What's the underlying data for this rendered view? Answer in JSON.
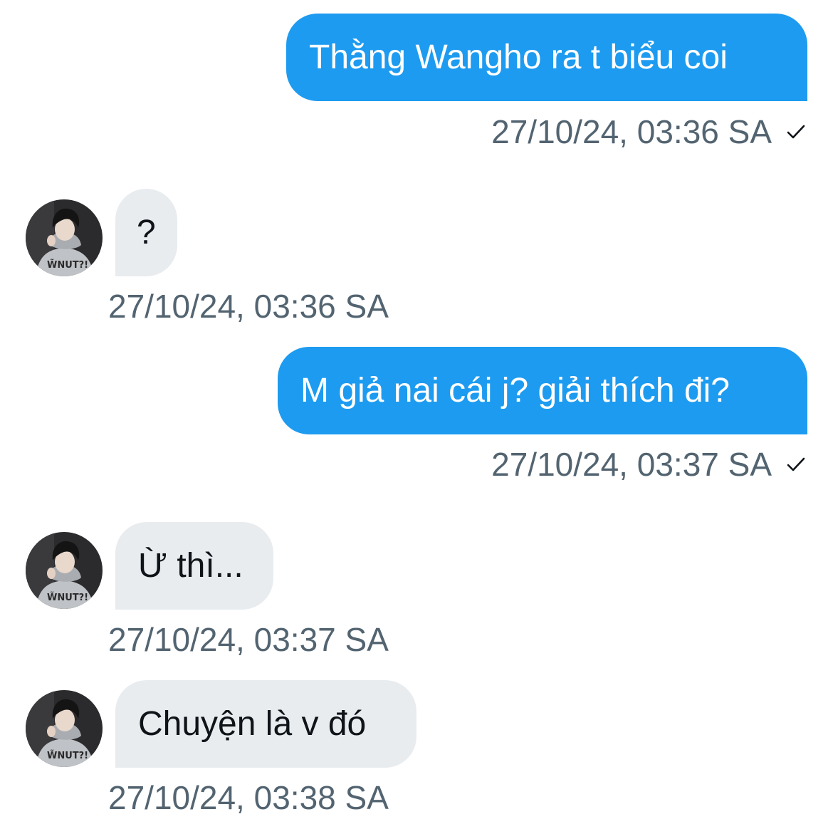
{
  "conversation": {
    "messages": [
      {
        "direction": "outgoing",
        "text": "Thằng Wangho ra t biểu coi",
        "timestamp": "27/10/24, 03:36 SA",
        "status_icon": "check-icon"
      },
      {
        "direction": "incoming",
        "text": "?",
        "timestamp": "27/10/24, 03:36 SA",
        "avatar": "avatar"
      },
      {
        "direction": "outgoing",
        "text": "M giả nai cái j? giải thích đi?",
        "timestamp": "27/10/24, 03:37 SA",
        "status_icon": "check-icon"
      },
      {
        "direction": "incoming",
        "text": "Ừ thì...",
        "timestamp": "27/10/24, 03:37 SA",
        "avatar": "avatar"
      },
      {
        "direction": "incoming",
        "text": "Chuyện là v đó",
        "timestamp": "27/10/24, 03:38 SA",
        "avatar": "avatar"
      }
    ]
  },
  "colors": {
    "outgoing_bubble": "#1d9bf0",
    "incoming_bubble": "#e9ecef",
    "timestamp_text": "#536471",
    "message_text": "#0f1419"
  }
}
